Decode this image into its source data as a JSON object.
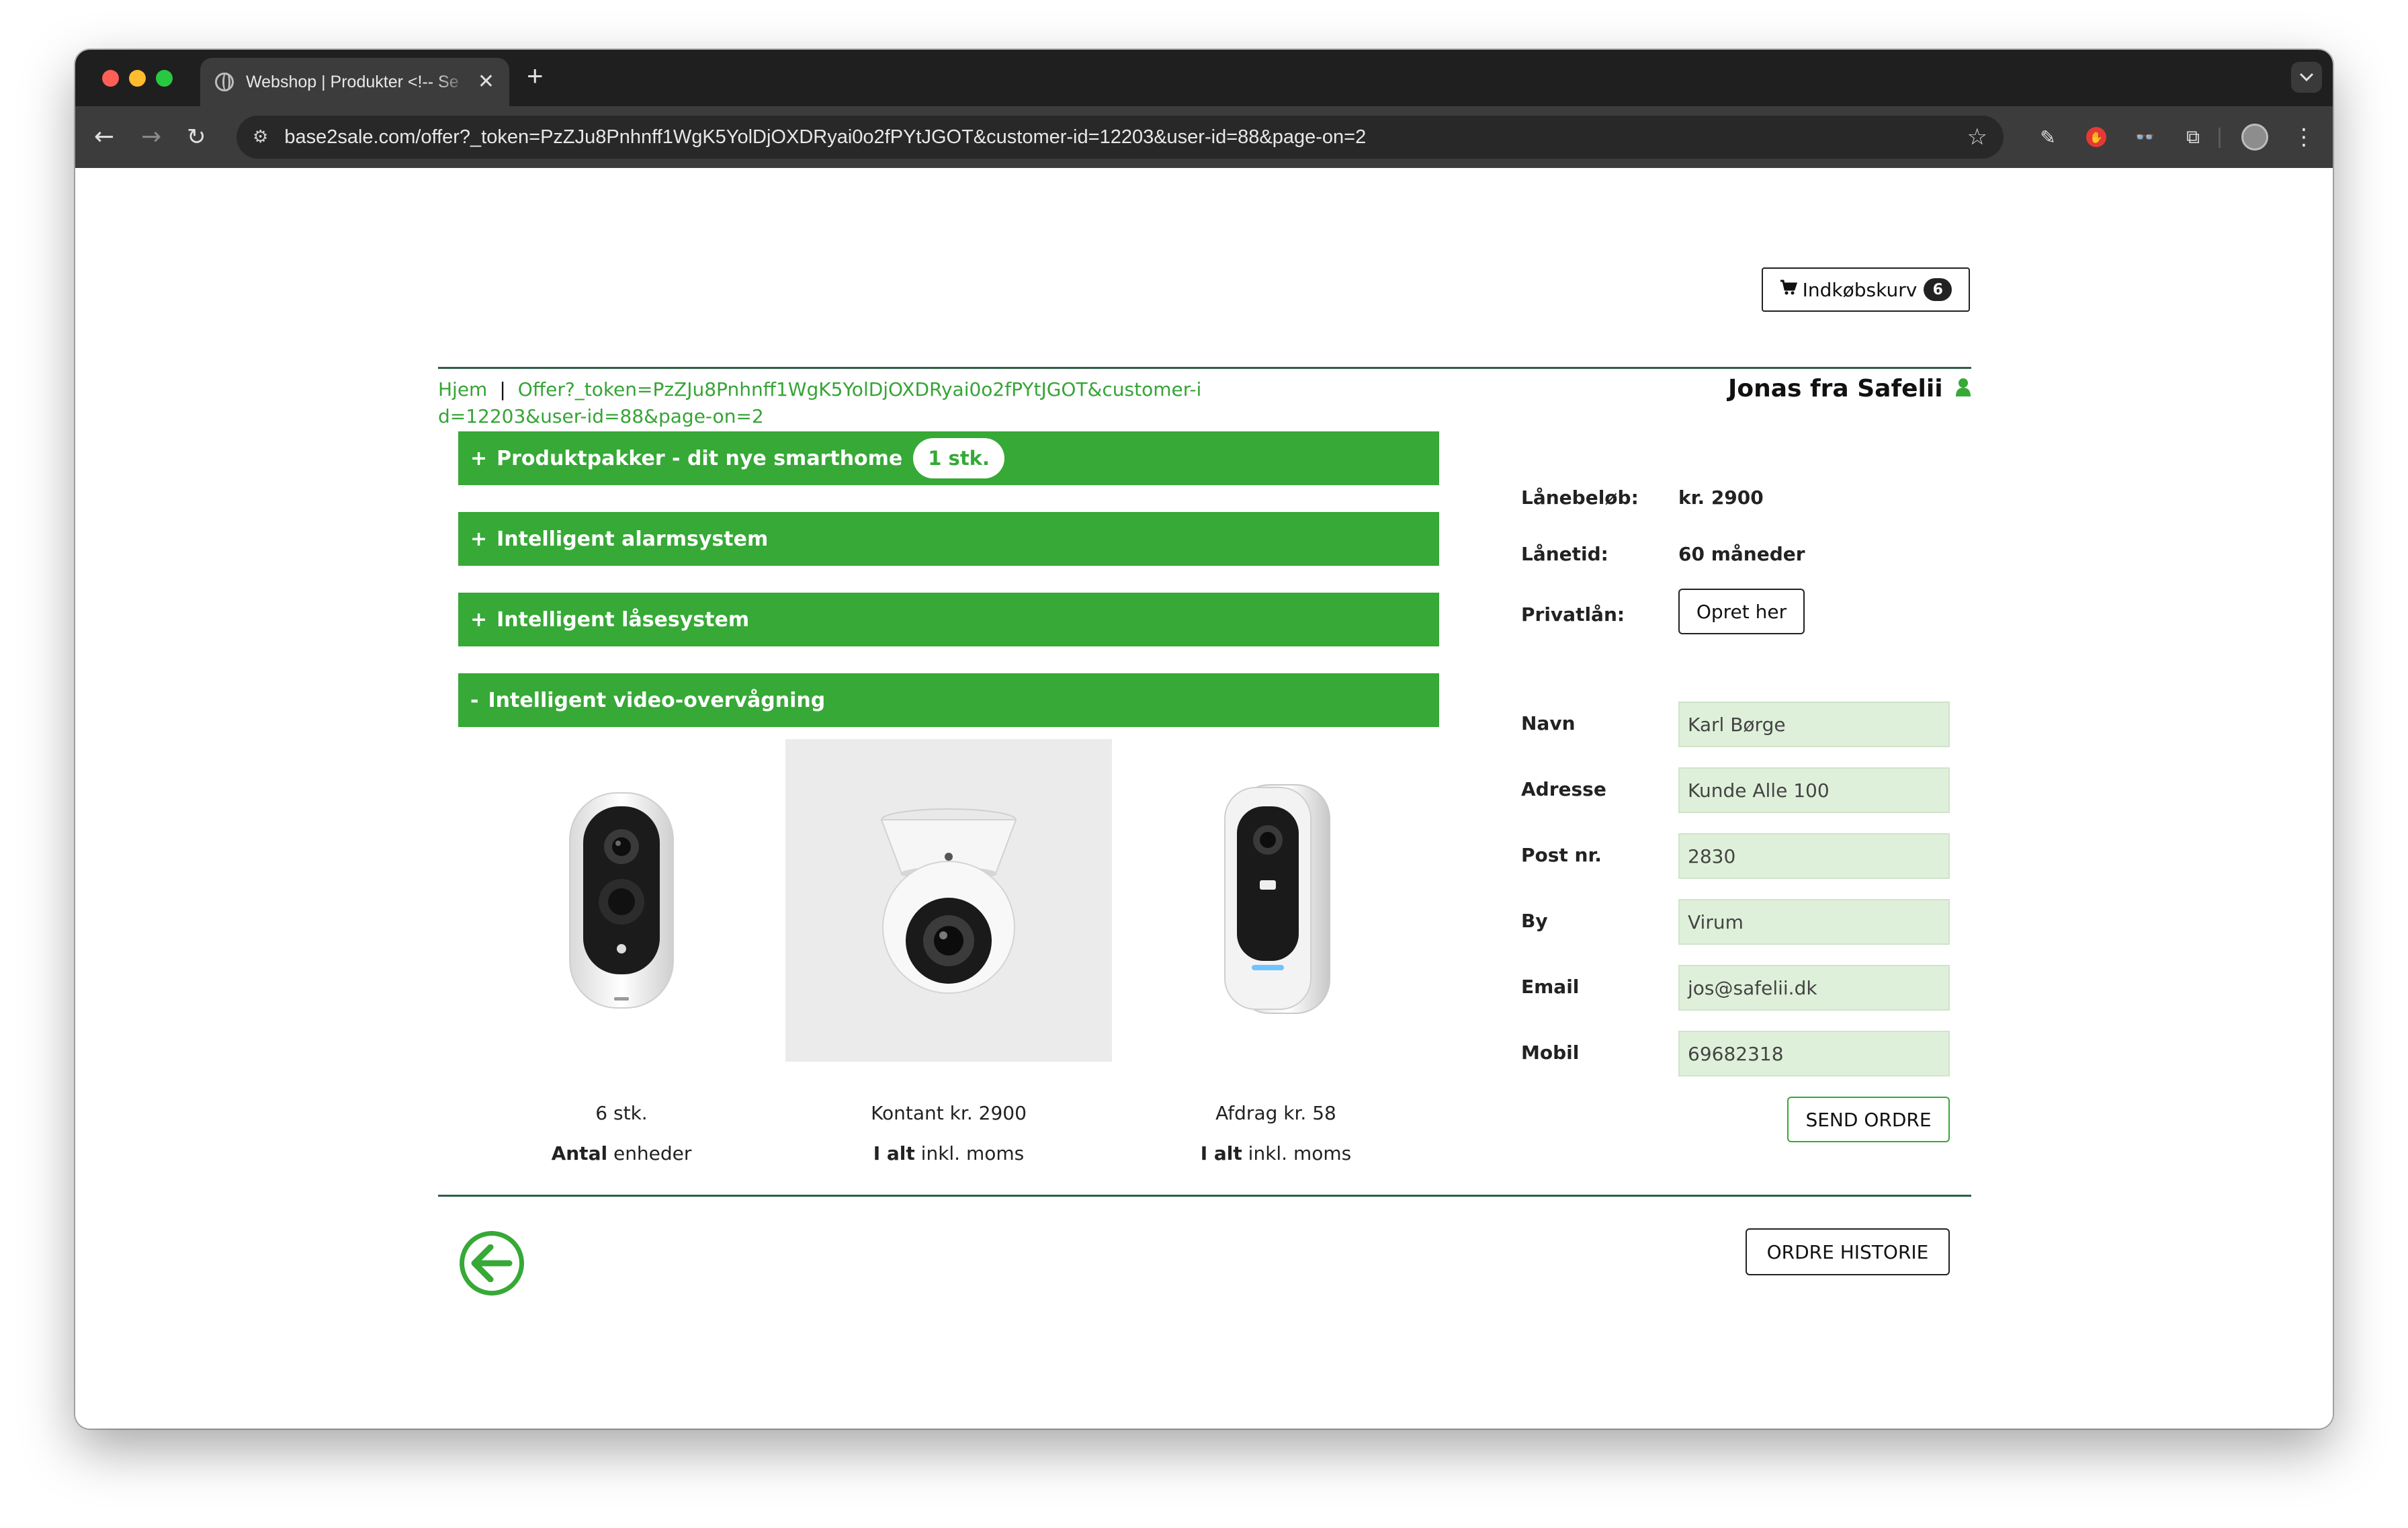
{
  "browser": {
    "tab_title": "Webshop | Produkter <!-- Se",
    "url": "base2sale.com/offer?_token=PzZJu8Pnhnff1WgK5YolDjOXDRyai0o2fPYtJGOT&customer-id=12203&user-id=88&page-on=2",
    "new_tab_symbol": "+",
    "close_symbol": "✕"
  },
  "header": {
    "cart_label": "Indkøbskurv",
    "cart_count": "6",
    "user_name": "Jonas fra Safelii"
  },
  "breadcrumb": {
    "home": "Hjem",
    "separator": "|",
    "current": "Offer?_token=PzZJu8Pnhnff1WgK5YolDjOXDRyai0o2fPYtJGOT&customer-id=12203&user-id=88&page-on=2"
  },
  "categories": [
    {
      "sign": "+",
      "label": "Produktpakker - dit nye smarthome",
      "badge": "1 stk."
    },
    {
      "sign": "+",
      "label": "Intelligent alarmsystem"
    },
    {
      "sign": "+",
      "label": "Intelligent låsesystem"
    },
    {
      "sign": "-",
      "label": "Intelligent video-overvågning"
    }
  ],
  "summary": [
    {
      "top": "6 stk.",
      "bold": "Antal",
      "rest": " enheder"
    },
    {
      "top": "Kontant kr. 2900",
      "bold": "I alt",
      "rest": " inkl. moms"
    },
    {
      "top": "Afdrag kr. 58",
      "bold": "I alt",
      "rest": " inkl. moms"
    }
  ],
  "loan": {
    "amount_label": "Lånebeløb:",
    "amount_value": "kr. 2900",
    "term_label": "Lånetid:",
    "term_value": "60 måneder",
    "private_label": "Privatlån:",
    "private_button": "Opret her"
  },
  "customer_form": {
    "name_label": "Navn",
    "name_value": "Karl Børge",
    "address_label": "Adresse",
    "address_value": "Kunde Alle 100",
    "zip_label": "Post nr.",
    "zip_value": "2830",
    "city_label": "By",
    "city_value": "Virum",
    "email_label": "Email",
    "email_value": "jos@safelii.dk",
    "mobile_label": "Mobil",
    "mobile_value": "69682318",
    "submit": "SEND ORDRE"
  },
  "footer": {
    "history_button": "ORDRE HISTORIE"
  },
  "colors": {
    "accent_green": "#36a936",
    "link_green": "#36a436",
    "field_bg": "#dff0da",
    "rule": "#2c5e46"
  }
}
